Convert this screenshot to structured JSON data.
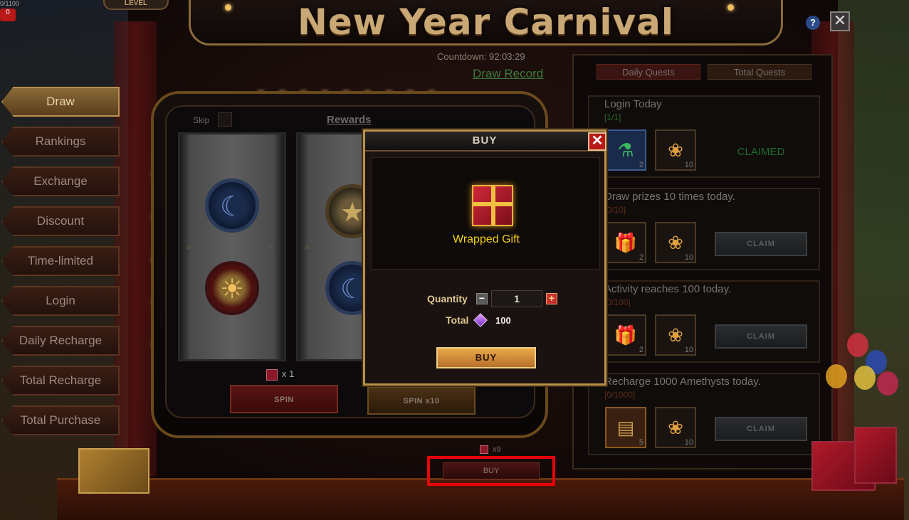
{
  "header": {
    "title": "New Year Carnival",
    "level_tag": "LEVEL",
    "top_left_value": "0/1100",
    "top_left_button": "0",
    "help_label": "?",
    "close_label": "✕"
  },
  "sidebar": {
    "items": [
      {
        "label": "Draw",
        "active": true
      },
      {
        "label": "Rankings"
      },
      {
        "label": "Exchange"
      },
      {
        "label": "Discount"
      },
      {
        "label": "Time-limited"
      },
      {
        "label": "Login"
      },
      {
        "label": "Daily Recharge"
      },
      {
        "label": "Total Recharge"
      },
      {
        "label": "Total Purchase"
      }
    ]
  },
  "slot": {
    "skip_label": "Skip",
    "rewards_label": "Rewards",
    "item_count": "x 1",
    "spin_label": "SPIN",
    "spin10_label": "SPIN x10",
    "reel_symbols": [
      "moon",
      "sun",
      "star",
      "moon"
    ]
  },
  "event": {
    "countdown": "Countdown: 92:03:29",
    "draw_record": "Draw Record"
  },
  "quests": {
    "tabs": [
      "Daily Quests",
      "Total Quests"
    ],
    "cards": [
      {
        "title": "Login Today",
        "progress": "[1/1]",
        "done": true,
        "rewards": [
          {
            "icon": "potion-icon",
            "qty": "2"
          },
          {
            "icon": "balloons-icon",
            "qty": "10"
          }
        ],
        "status": "CLAIMED"
      },
      {
        "title": "Draw prizes 10 times today.",
        "progress": "[0/10]",
        "done": false,
        "rewards": [
          {
            "icon": "gift-icon",
            "qty": "2"
          },
          {
            "icon": "balloons-icon",
            "qty": "10"
          }
        ],
        "status": "CLAIM"
      },
      {
        "title": "Activity reaches 100 today.",
        "progress": "[0/100]",
        "done": false,
        "rewards": [
          {
            "icon": "gift-icon",
            "qty": "2"
          },
          {
            "icon": "balloons-icon",
            "qty": "10"
          }
        ],
        "status": "CLAIM"
      },
      {
        "title": "Recharge 1000 Amethysts today.",
        "progress": "[0/1000]",
        "done": false,
        "rewards": [
          {
            "icon": "card-icon",
            "qty": "5"
          },
          {
            "icon": "balloons-icon",
            "qty": "10"
          }
        ],
        "status": "CLAIM"
      }
    ]
  },
  "bottom": {
    "item_count": "x9",
    "buy_label": "BUY"
  },
  "modal": {
    "title": "BUY",
    "close_label": "✕",
    "item_name": "Wrapped Gift",
    "quantity_label": "Quantity",
    "quantity_value": "1",
    "minus_label": "−",
    "plus_label": "+",
    "total_label": "Total",
    "total_value": "100",
    "buy_label": "BUY"
  },
  "colors": {
    "accent_gold": "#c9a875",
    "claimed_green": "#1e6a2e",
    "highlight_red": "#e8000b",
    "gift_name_yellow": "#f0d020"
  }
}
